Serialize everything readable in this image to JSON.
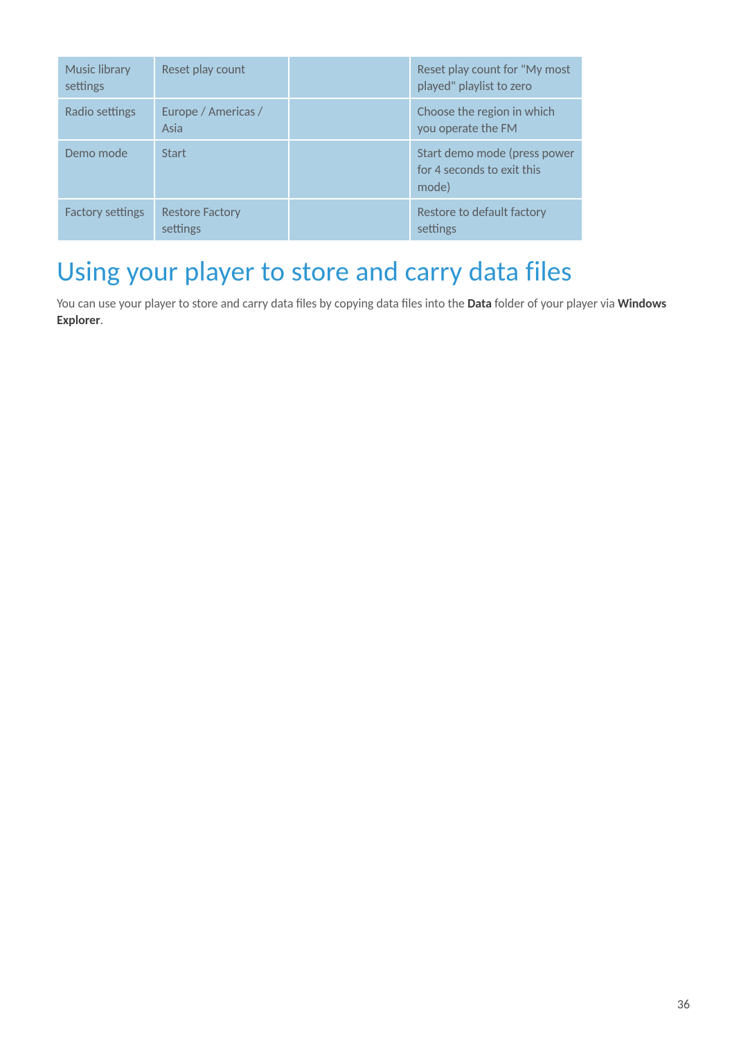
{
  "table": {
    "rows": [
      {
        "c1": "Music library settings",
        "c2": "Reset play count",
        "c3": "",
        "c4": "Reset play count for \"My most played\" playlist to zero"
      },
      {
        "c1": "Radio settings",
        "c2": "Europe / Americas / Asia",
        "c3": "",
        "c4": "Choose the region in which you operate the FM"
      },
      {
        "c1": "Demo mode",
        "c2": "Start",
        "c3": "",
        "c4": "Start demo mode (press power for 4 seconds to exit this mode)"
      },
      {
        "c1": "Factory settings",
        "c2": "Restore Factory settings",
        "c3": "",
        "c4": "Restore to default factory settings"
      }
    ]
  },
  "heading": "Using your player to store and carry data files",
  "para": {
    "pre": "You can use your player to store and carry data files by copying data files into the ",
    "bold1": "Data",
    "mid": " folder of your player via ",
    "bold2": "Windows Explorer",
    "post": "."
  },
  "page_number": "36"
}
